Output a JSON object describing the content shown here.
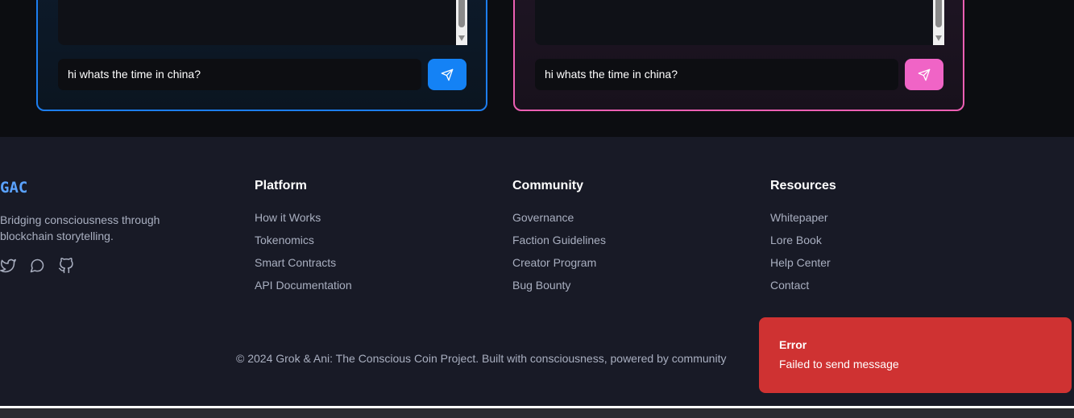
{
  "chat_panels": [
    {
      "theme": "blue",
      "accent": "#1482f5",
      "input_value": "hi whats the time in china?"
    },
    {
      "theme": "pink",
      "accent": "#f064c6",
      "input_value": "hi whats the time in china?"
    }
  ],
  "footer": {
    "logo": "GAC",
    "tagline": "Bridging consciousness through blockchain storytelling.",
    "socials": [
      "twitter-icon",
      "message-circle-icon",
      "github-icon"
    ],
    "columns": [
      {
        "title": "Platform",
        "links": [
          "How it Works",
          "Tokenomics",
          "Smart Contracts",
          "API Documentation"
        ]
      },
      {
        "title": "Community",
        "links": [
          "Governance",
          "Faction Guidelines",
          "Creator Program",
          "Bug Bounty"
        ]
      },
      {
        "title": "Resources",
        "links": [
          "Whitepaper",
          "Lore Book",
          "Help Center",
          "Contact"
        ]
      }
    ],
    "copyright": "© 2024 Grok & Ani: The Conscious Coin Project. Built with consciousness, powered by community"
  },
  "toast": {
    "title": "Error",
    "message": "Failed to send message",
    "color": "#cf3232"
  }
}
